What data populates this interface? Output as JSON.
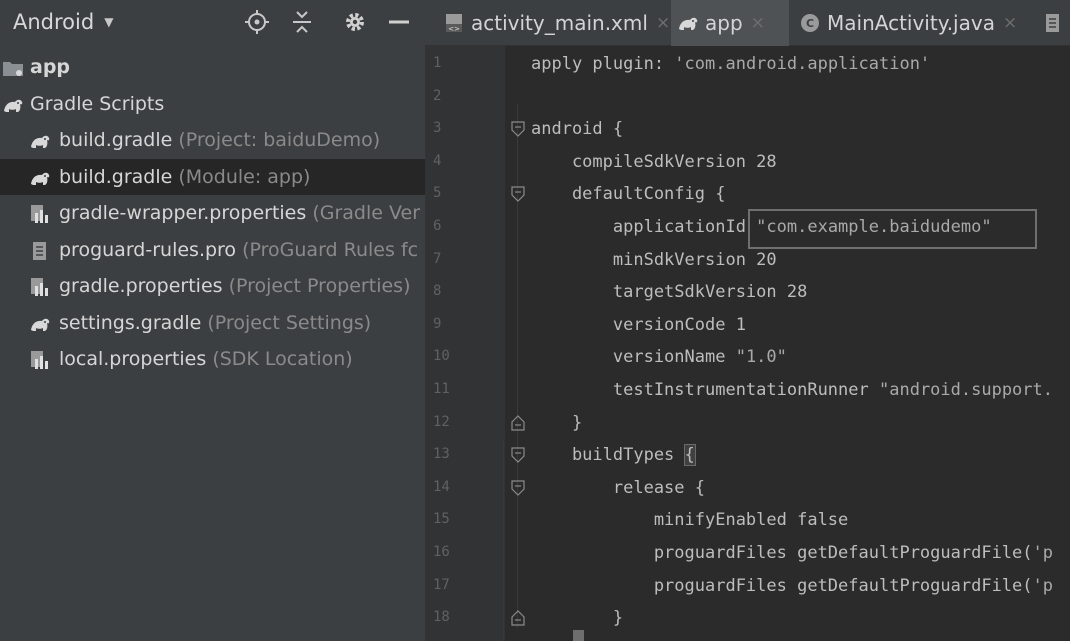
{
  "project_panel": {
    "view_selector": "Android",
    "tree": [
      {
        "label": "app",
        "hint": "",
        "icon": "folder-app-icon",
        "level": 0,
        "bold": true,
        "selected": false
      },
      {
        "label": "Gradle Scripts",
        "hint": "",
        "icon": "gradle-icon",
        "level": 0,
        "bold": false,
        "selected": false
      },
      {
        "label": "build.gradle",
        "hint": " (Project: baiduDemo)",
        "icon": "gradle-icon",
        "level": 1,
        "bold": false,
        "selected": false
      },
      {
        "label": "build.gradle",
        "hint": " (Module: app)",
        "icon": "gradle-icon",
        "level": 1,
        "bold": false,
        "selected": true
      },
      {
        "label": "gradle-wrapper.properties",
        "hint": " (Gradle Ver",
        "icon": "properties-file-icon",
        "level": 1,
        "bold": false,
        "selected": false
      },
      {
        "label": "proguard-rules.pro",
        "hint": " (ProGuard Rules fc",
        "icon": "text-file-icon",
        "level": 1,
        "bold": false,
        "selected": false
      },
      {
        "label": "gradle.properties",
        "hint": " (Project Properties)",
        "icon": "properties-file-icon",
        "level": 1,
        "bold": false,
        "selected": false
      },
      {
        "label": "settings.gradle",
        "hint": " (Project Settings)",
        "icon": "gradle-icon",
        "level": 1,
        "bold": false,
        "selected": false
      },
      {
        "label": "local.properties",
        "hint": " (SDK Location)",
        "icon": "properties-file-icon",
        "level": 1,
        "bold": false,
        "selected": false
      }
    ]
  },
  "tabs": [
    {
      "label": "activity_main.xml",
      "icon": "xml-file-icon",
      "active": false
    },
    {
      "label": "app",
      "icon": "gradle-icon",
      "active": true
    },
    {
      "label": "MainActivity.java",
      "icon": "java-class-icon",
      "active": false
    }
  ],
  "editor": {
    "line_numbers": [
      "1",
      "2",
      "3",
      "4",
      "5",
      "6",
      "7",
      "8",
      "9",
      "10",
      "11",
      "12",
      "13",
      "14",
      "15",
      "16",
      "17",
      "18"
    ],
    "lines": [
      "apply plugin: 'com.android.application'",
      "",
      "android {",
      "    compileSdkVersion 28",
      "    defaultConfig {",
      "        applicationId \"com.example.baidudemo\"",
      "        minSdkVersion 20",
      "        targetSdkVersion 28",
      "        versionCode 1",
      "        versionName \"1.0\"",
      "        testInstrumentationRunner \"android.support.",
      "    }",
      "    buildTypes {",
      "        release {",
      "            minifyEnabled false",
      "            proguardFiles getDefaultProguardFile('p",
      "            proguardFiles getDefaultProguardFile('p",
      "        }"
    ]
  },
  "colors": {
    "panel_bg": "#3c3f41",
    "editor_bg": "#2b2b2b",
    "gutter_bg": "#313335",
    "selected_row": "#262626",
    "active_tab": "#4e5254"
  }
}
